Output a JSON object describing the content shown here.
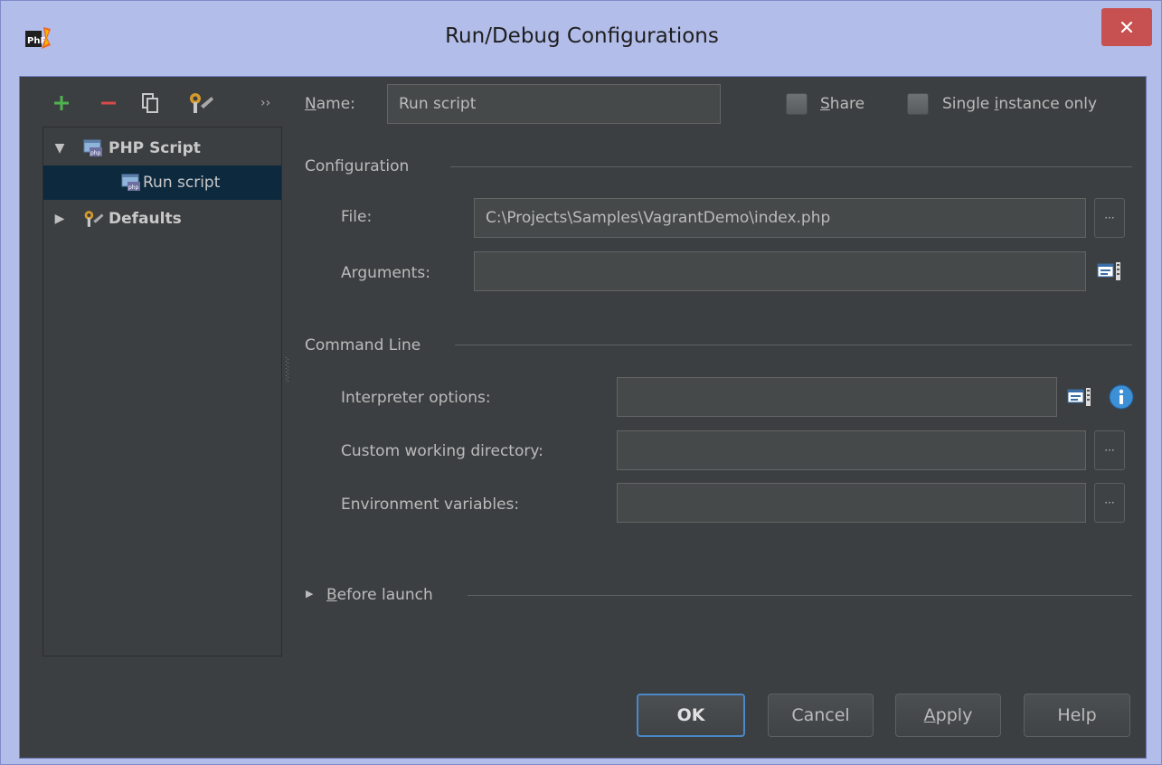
{
  "window": {
    "title": "Run/Debug Configurations",
    "app_icon": "phpstorm-icon",
    "close_icon": "close-icon"
  },
  "toolbar": {
    "icons": [
      "add-icon",
      "remove-icon",
      "copy-icon",
      "wrench-icon",
      "more-chevron-icon"
    ],
    "more_glyph": "››"
  },
  "tree": {
    "items": [
      {
        "label": "PHP Script",
        "expanded": true,
        "icon": "php-script-icon"
      },
      {
        "label": "Run script",
        "selected": true,
        "icon": "php-script-icon"
      },
      {
        "label": "Defaults",
        "expanded": false,
        "icon": "wrench-icon"
      }
    ]
  },
  "header": {
    "name_label_u": "N",
    "name_label_rest": "ame:",
    "name_value": "Run script",
    "share_label_u": "S",
    "share_label_rest": "hare",
    "single_label_pre": "Single ",
    "single_label_u": "i",
    "single_label_rest": "nstance only"
  },
  "configuration": {
    "title": "Configuration",
    "file_label": "File:",
    "file_value": "C:\\Projects\\Samples\\VagrantDemo\\index.php",
    "arguments_label": "Arguments:",
    "arguments_value": ""
  },
  "command_line": {
    "title": "Command Line",
    "interpreter_label": "Interpreter options:",
    "interpreter_value": "",
    "workdir_label": "Custom working directory:",
    "workdir_value": "",
    "env_label": "Environment variables:",
    "env_value": ""
  },
  "before_launch": {
    "label_u": "B",
    "label_rest": "efore launch"
  },
  "buttons": {
    "ok": "OK",
    "cancel": "Cancel",
    "apply_u": "A",
    "apply_rest": "pply",
    "help": "Help"
  },
  "browse_glyph": "···",
  "colors": {
    "background": "#3c3f41",
    "selection": "#0d293e",
    "frame": "#b3bdea",
    "close": "#c75050",
    "accent": "#4a88c7"
  }
}
